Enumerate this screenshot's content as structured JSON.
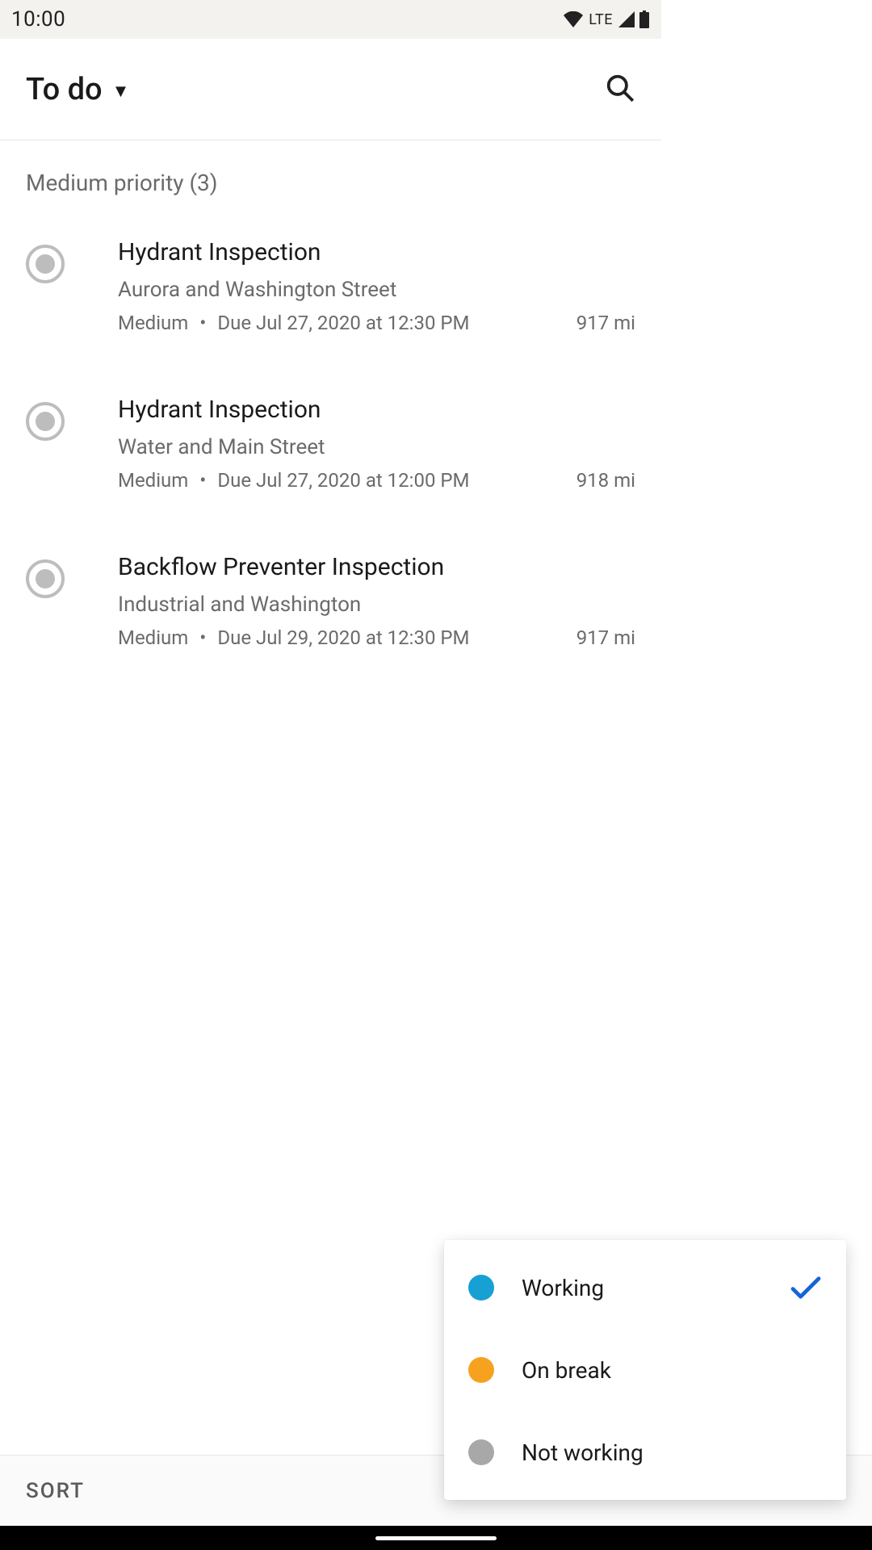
{
  "status": {
    "time": "10:00",
    "network": "LTE"
  },
  "header": {
    "title": "To do"
  },
  "section": {
    "label": "Medium priority (3)"
  },
  "tasks": [
    {
      "title": "Hydrant Inspection",
      "location": "Aurora and Washington Street",
      "priority": "Medium",
      "due": "Due Jul 27, 2020 at 12:30 PM",
      "distance": "917 mi"
    },
    {
      "title": "Hydrant Inspection",
      "location": "Water and Main Street",
      "priority": "Medium",
      "due": "Due Jul 27, 2020 at 12:00 PM",
      "distance": "918 mi"
    },
    {
      "title": "Backflow Preventer Inspection",
      "location": "Industrial and Washington",
      "priority": "Medium",
      "due": "Due Jul 29, 2020 at 12:30 PM",
      "distance": "917 mi"
    }
  ],
  "bottom": {
    "sort": "SORT"
  },
  "status_menu": {
    "items": [
      {
        "label": "Working",
        "color": "working",
        "selected": true
      },
      {
        "label": "On break",
        "color": "break",
        "selected": false
      },
      {
        "label": "Not working",
        "color": "notwork",
        "selected": false
      }
    ]
  }
}
